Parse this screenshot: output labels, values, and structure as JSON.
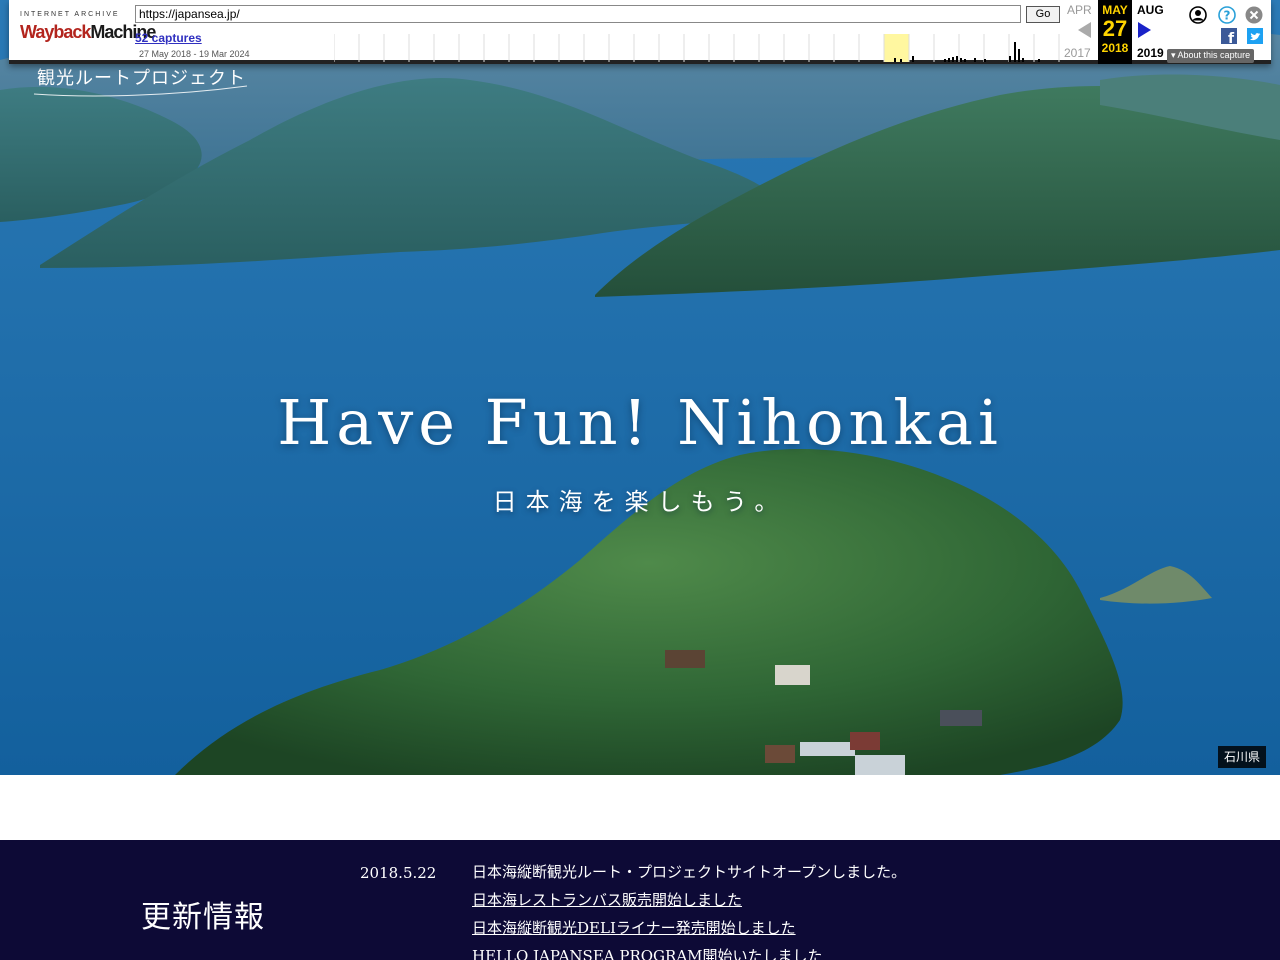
{
  "wayback": {
    "logo_top": "INTERNET ARCHIVE",
    "logo_main_a": "Wayback",
    "logo_main_b": "Machine",
    "url_value": "https://japansea.jp/",
    "go_label": "Go",
    "captures_label": "52 captures",
    "date_range": "27 May 2018 - 19 Mar 2024",
    "prev_month": "APR",
    "prev_year": "2017",
    "current_month": "MAY",
    "current_day": "27",
    "current_year": "2018",
    "next_month": "AUG",
    "next_year": "2019",
    "about_label": "About this capture",
    "icons": [
      "user-icon",
      "help-icon",
      "close-icon",
      "facebook-icon",
      "twitter-icon"
    ]
  },
  "site": {
    "logo_text": "観光ルートプロジェクト",
    "hero_title": "Have Fun! Nihonkai",
    "hero_subtitle": "日本海を楽しもう。",
    "location_tag": "石川県"
  },
  "news": {
    "heading": "更新情報",
    "date": "2018.5.22",
    "items": [
      {
        "text": "日本海縦断観光ルート・プロジェクトサイトオープンしました。",
        "link": false
      },
      {
        "text": "日本海レストランバス販売開始しました",
        "link": true
      },
      {
        "text": "日本海縦断観光DELIライナー発売開始しました",
        "link": true
      },
      {
        "text": "HELLO JAPANSEA PROGRAM開始いたしました",
        "link": true
      }
    ]
  },
  "colors": {
    "news_bg": "#0d0a36",
    "wayback_accent": "#ffd400",
    "wayback_link": "#3030c0"
  }
}
